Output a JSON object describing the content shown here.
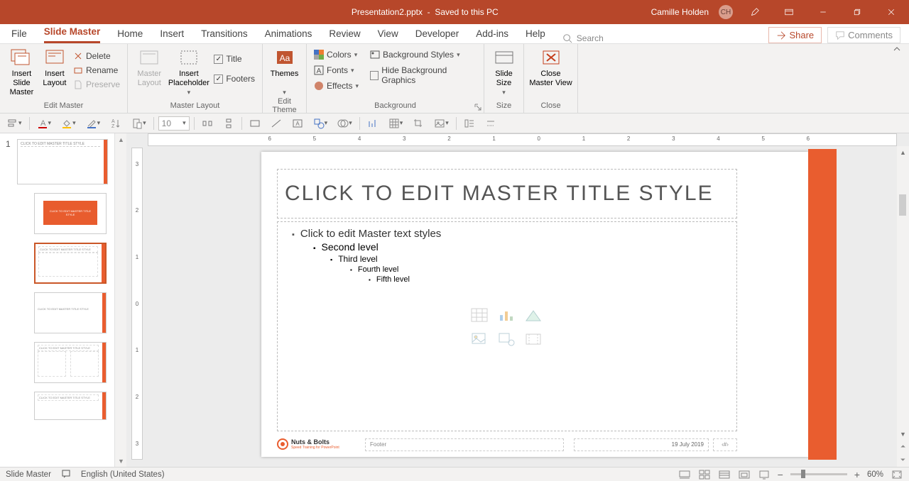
{
  "titlebar": {
    "filename": "Presentation2.pptx",
    "saved_status": "Saved to this PC",
    "user_name": "Camille Holden",
    "user_initials": "CH"
  },
  "tabs": {
    "items": [
      "File",
      "Slide Master",
      "Home",
      "Insert",
      "Transitions",
      "Animations",
      "Review",
      "View",
      "Developer",
      "Add-ins",
      "Help"
    ],
    "active": "Slide Master",
    "search_placeholder": "Search"
  },
  "right_buttons": {
    "share": "Share",
    "comments": "Comments"
  },
  "ribbon": {
    "edit_master": {
      "insert_slide_master": "Insert Slide\nMaster",
      "insert_layout": "Insert\nLayout",
      "delete": "Delete",
      "rename": "Rename",
      "preserve": "Preserve",
      "label": "Edit Master"
    },
    "master_layout": {
      "master_layout": "Master\nLayout",
      "insert_placeholder": "Insert\nPlaceholder",
      "title": "Title",
      "footers": "Footers",
      "label": "Master Layout"
    },
    "edit_theme": {
      "themes": "Themes",
      "label": "Edit Theme"
    },
    "background": {
      "colors": "Colors",
      "fonts": "Fonts",
      "effects": "Effects",
      "bg_styles": "Background Styles",
      "hide_bg": "Hide Background Graphics",
      "label": "Background"
    },
    "size": {
      "slide_size": "Slide\nSize",
      "label": "Size"
    },
    "close": {
      "close_master": "Close\nMaster View",
      "label": "Close"
    }
  },
  "sec_toolbar": {
    "fontsize": "10"
  },
  "ruler": {
    "h_ticks": [
      "6",
      "5",
      "4",
      "3",
      "2",
      "1",
      "0",
      "1",
      "2",
      "3",
      "4",
      "5",
      "6"
    ],
    "v_ticks": [
      "3",
      "2",
      "1",
      "0",
      "1",
      "2",
      "3"
    ]
  },
  "thumbnails": {
    "master_number": "1"
  },
  "slide": {
    "title": "CLICK TO EDIT MASTER TITLE STYLE",
    "levels": {
      "l1": "Click to edit Master text styles",
      "l2": "Second level",
      "l3": "Third level",
      "l4": "Fourth level",
      "l5": "Fifth level"
    },
    "logo_name": "Nuts & Bolts",
    "logo_sub": "Speed Training for PowerPoint",
    "footer": "Footer",
    "date": "19 July 2019",
    "slideno": "‹#›"
  },
  "statusbar": {
    "mode": "Slide Master",
    "language": "English (United States)",
    "zoom": "60%"
  }
}
